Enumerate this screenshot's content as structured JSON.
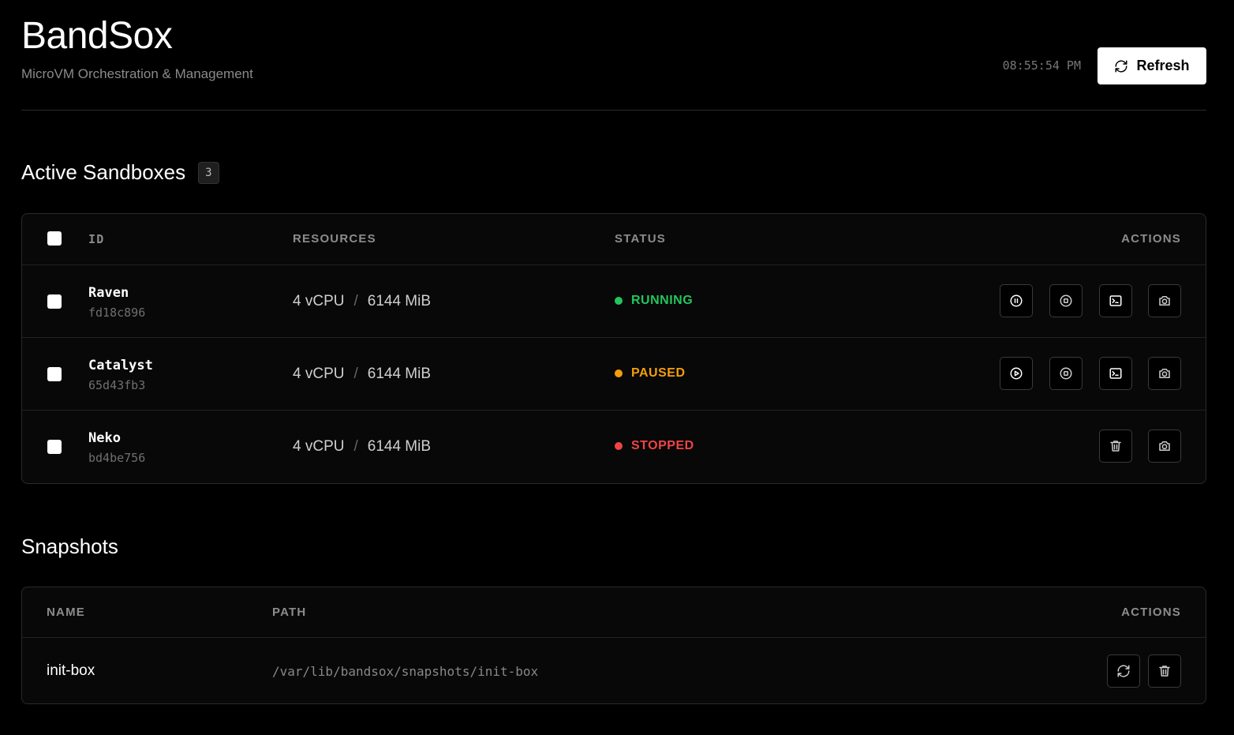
{
  "header": {
    "title": "BandSox",
    "subtitle": "MicroVM Orchestration & Management",
    "clock": "08:55:54 PM",
    "refresh_label": "Refresh"
  },
  "sandboxes": {
    "title": "Active Sandboxes",
    "count": "3",
    "columns": {
      "id": "ID",
      "resources": "RESOURCES",
      "status": "STATUS",
      "actions": "ACTIONS"
    },
    "rows": [
      {
        "name": "Raven",
        "id": "fd18c896",
        "cpu": "4 vCPU",
        "sep": "/",
        "mem": "6144 MiB",
        "status": "RUNNING",
        "status_color": "#22c55e"
      },
      {
        "name": "Catalyst",
        "id": "65d43fb3",
        "cpu": "4 vCPU",
        "sep": "/",
        "mem": "6144 MiB",
        "status": "PAUSED",
        "status_color": "#f59e0b"
      },
      {
        "name": "Neko",
        "id": "bd4be756",
        "cpu": "4 vCPU",
        "sep": "/",
        "mem": "6144 MiB",
        "status": "STOPPED",
        "status_color": "#ef4444"
      }
    ]
  },
  "snapshots": {
    "title": "Snapshots",
    "columns": {
      "name": "NAME",
      "path": "PATH",
      "actions": "ACTIONS"
    },
    "rows": [
      {
        "name": "init-box",
        "path": "/var/lib/bandsox/snapshots/init-box"
      }
    ]
  }
}
